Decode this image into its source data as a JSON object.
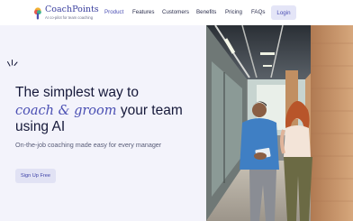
{
  "brand": {
    "name": "CoachPoints",
    "tagline": "AI co-pilot for team coaching",
    "colors": {
      "primary": "#4a4fb3",
      "dark_text": "#16193a",
      "hero_bg": "#f3f3fb",
      "button_bg": "#e1e2f4"
    }
  },
  "nav": {
    "items": [
      {
        "label": "Product",
        "active": true
      },
      {
        "label": "Features",
        "active": false
      },
      {
        "label": "Customers",
        "active": false
      },
      {
        "label": "Benefits",
        "active": false
      },
      {
        "label": "Pricing",
        "active": false
      },
      {
        "label": "FAQs",
        "active": false
      }
    ],
    "login_label": "Login"
  },
  "hero": {
    "headline_line1": "The simplest way to",
    "headline_accent": "coach & groom",
    "headline_line2_rest": " your team",
    "headline_line3": "using AI",
    "subtitle": "On-the-job coaching made easy for every manager",
    "cta_label": "Sign Up Free",
    "decoration_icon": "sparkle-lines-icon"
  },
  "photo": {
    "subject": "office-corridor-two-colleagues-with-tablet"
  }
}
